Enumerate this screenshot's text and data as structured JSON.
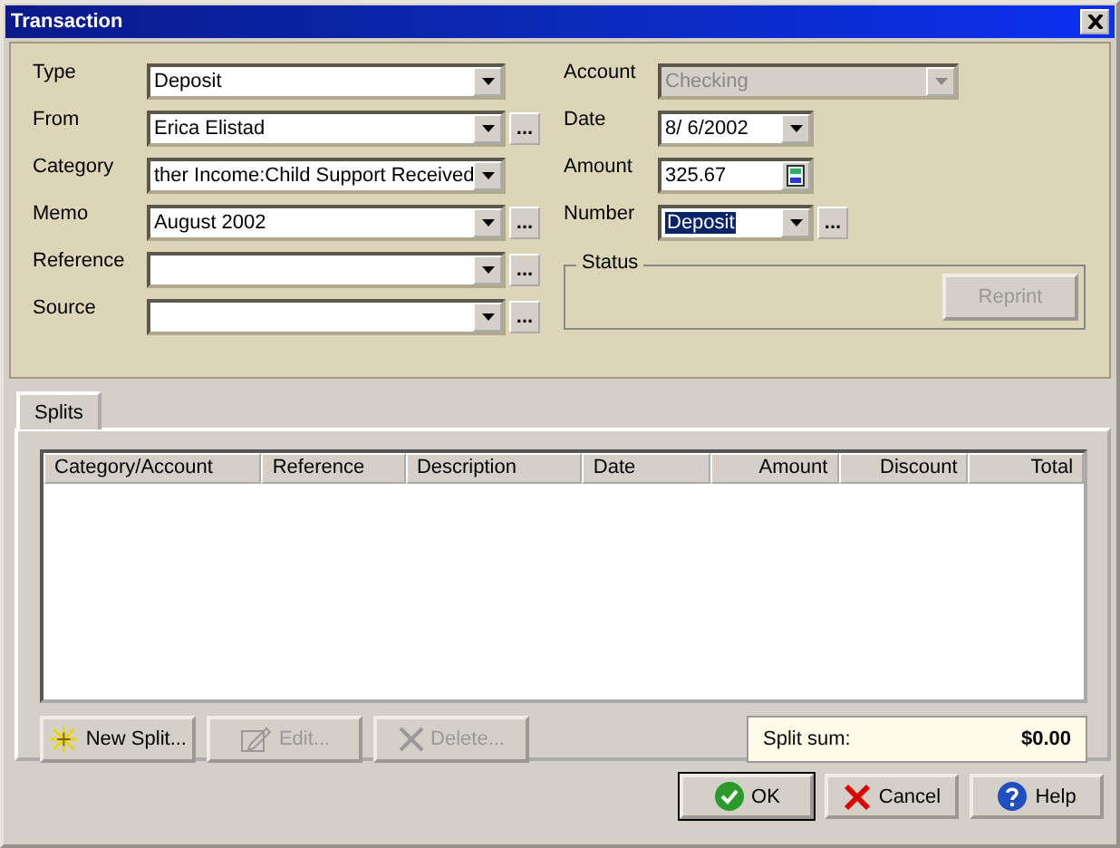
{
  "window": {
    "title": "Transaction"
  },
  "left_fields": [
    {
      "label": "Type",
      "value": "Deposit",
      "kind": "combo",
      "disabled": false
    },
    {
      "label": "From",
      "value": "Erica Elistad",
      "kind": "combo",
      "browse_label": "...",
      "disabled": false
    },
    {
      "label": "Category",
      "value": "ther Income:Child Support Received",
      "kind": "combo",
      "disabled": false
    },
    {
      "label": "Memo",
      "value": "August 2002",
      "kind": "combo",
      "browse_label": "...",
      "disabled": false
    },
    {
      "label": "Reference",
      "kind": "combo",
      "browse_label": "...",
      "disabled": false
    },
    {
      "label": "Source",
      "kind": "combo",
      "browse_label": "...",
      "disabled": false
    }
  ],
  "right_fields": [
    {
      "label": "Account",
      "value": "Checking",
      "kind": "combo",
      "disabled": true,
      "highlighted": false
    },
    {
      "label": "Date",
      "value": "8/  6/2002",
      "kind": "combo",
      "disabled": false,
      "highlighted": false
    },
    {
      "label": "Amount",
      "value": "325.67",
      "kind": "calc",
      "disabled": false,
      "highlighted": false
    },
    {
      "label": "Number",
      "value": "Deposit",
      "kind": "combo",
      "browse_label": "...",
      "disabled": false,
      "highlighted": true
    }
  ],
  "status": {
    "title": "Status",
    "button": {
      "label": "Reprint",
      "disabled": true
    }
  },
  "tabs": [
    {
      "label": "Splits",
      "selected": true
    }
  ],
  "table": {
    "columns": [
      "Category/Account",
      "Reference",
      "Description",
      "Date",
      "Amount",
      "Discount",
      "Total"
    ]
  },
  "split_buttons": [
    {
      "label": "New Split...",
      "disabled": false
    },
    {
      "label": "Edit...",
      "disabled": true
    },
    {
      "label": "Delete...",
      "disabled": true
    }
  ],
  "split_sum": {
    "label": "Split sum:",
    "value": "$0.00"
  },
  "dialog_buttons": [
    {
      "label": "OK",
      "default": true
    },
    {
      "label": "Cancel",
      "default": false
    },
    {
      "label": "Help",
      "default": false
    }
  ]
}
